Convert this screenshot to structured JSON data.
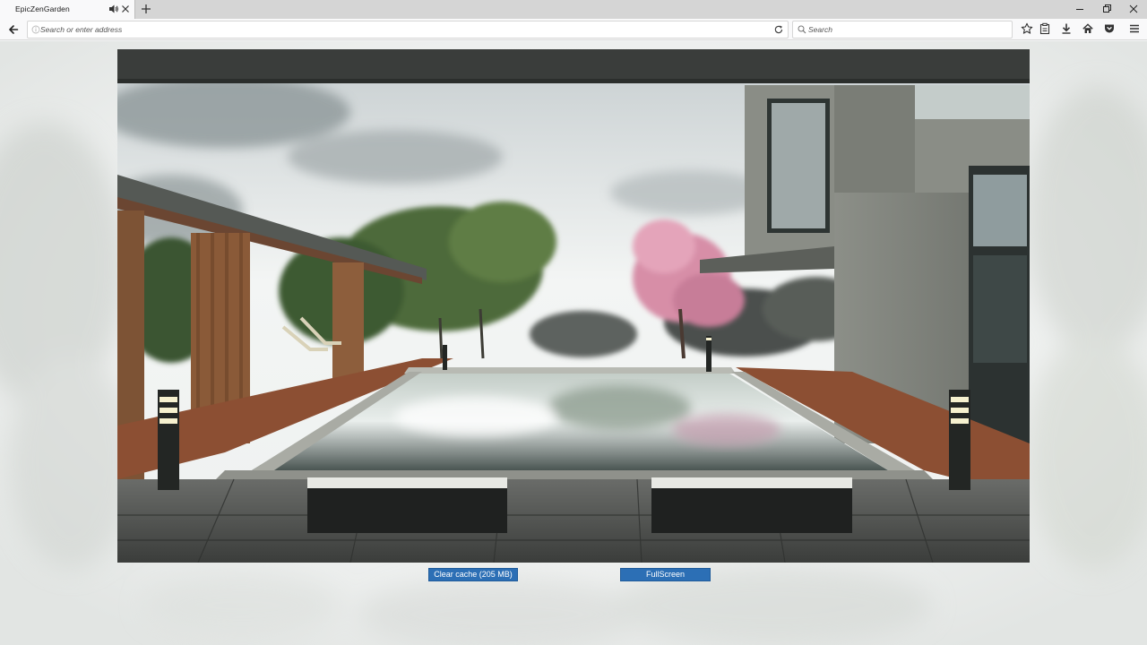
{
  "browser": {
    "tab": {
      "title": "EpicZenGarden"
    },
    "address_bar": {
      "placeholder": "Search or enter address",
      "value": ""
    },
    "search_bar": {
      "placeholder": "Search",
      "value": ""
    },
    "icons": {
      "back": "back-arrow-icon",
      "reload": "reload-icon",
      "bookmark": "star-icon",
      "reading_list": "clipboard-icon",
      "downloads": "download-icon",
      "home": "home-icon",
      "pocket": "pocket-icon",
      "menu": "hamburger-menu-icon"
    }
  },
  "page": {
    "buttons": {
      "clear_cache": "Clear cache (205 MB)",
      "fullscreen": "FullScreen"
    },
    "colors": {
      "button_bg": "#2c6fb5",
      "button_text": "#ffffff"
    }
  }
}
